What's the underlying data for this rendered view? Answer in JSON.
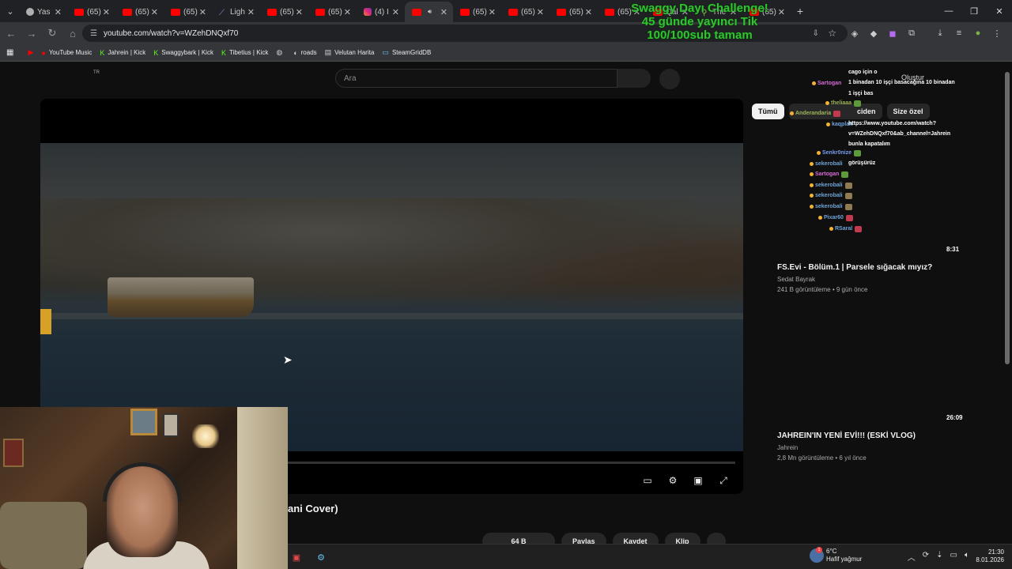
{
  "browser": {
    "tabs": [
      {
        "label": "Yas",
        "icon": "doc"
      },
      {
        "label": "(65)",
        "icon": "yt"
      },
      {
        "label": "(65)",
        "icon": "yt"
      },
      {
        "label": "(65)",
        "icon": "yt"
      },
      {
        "label": "Ligh",
        "icon": "feather"
      },
      {
        "label": "(65)",
        "icon": "yt"
      },
      {
        "label": "(65)",
        "icon": "yt"
      },
      {
        "label": "(4) I",
        "icon": "ig"
      },
      {
        "label": "",
        "icon": "yt",
        "active": true
      },
      {
        "label": "(65)",
        "icon": "yt"
      },
      {
        "label": "(65)",
        "icon": "yt"
      },
      {
        "label": "(65)",
        "icon": "yt"
      },
      {
        "label": "(65)",
        "icon": "yt"
      },
      {
        "label": "Qal",
        "icon": "yt"
      },
      {
        "label": "The",
        "icon": "person"
      },
      {
        "label": "(65)",
        "icon": "yt"
      }
    ],
    "url": "youtube.com/watch?v=WZehDNQxf70",
    "bookmarks": [
      {
        "label": "YouTube Music",
        "icon": "youtube-music-icon"
      },
      {
        "label": "Jahrein | Kick",
        "icon": "kick-icon"
      },
      {
        "label": "Swaggybark | Kick",
        "icon": "kick-icon"
      },
      {
        "label": "Tibetius | Kick",
        "icon": "kick-icon"
      },
      {
        "label": "",
        "icon": "globe-icon"
      },
      {
        "label": "roads",
        "icon": "roads-icon"
      },
      {
        "label": "Velutan Harita",
        "icon": "map-icon"
      },
      {
        "label": "SteamGridDB",
        "icon": "steam-icon"
      }
    ]
  },
  "overlay": {
    "line1": "Swaggy Dayı Challenge!",
    "line2": "45 günde yayıncı Tik",
    "line3": "100/100sub tamam"
  },
  "youtube": {
    "lang": "TR",
    "search_placeholder": "Ara",
    "create": "Oluştur",
    "video_title_partial": "ani Cover)",
    "actions": {
      "likes": "64 B",
      "share": "Paylaş",
      "save": "Kaydet",
      "clip": "Klip"
    },
    "chips": {
      "all": "Tümü",
      "middle": "ciden",
      "for_you": "Size özel"
    },
    "recommendations": [
      {
        "title": "FS.Evi - Bölüm.1 | Parsele sığacak mıyız?",
        "channel": "Sedat Bayrak",
        "meta": "241 B görüntüleme • 9 gün önce",
        "duration": "8:31"
      },
      {
        "title": "JAHREIN'IN YENİ EVİ!!! (ESKİ VLOG)",
        "channel": "Jahrein",
        "meta": "2,8 Mn görüntüleme • 6 yıl önce",
        "duration": "26:09"
      }
    ]
  },
  "chat": {
    "lines": [
      {
        "user": "",
        "text": "cago için o"
      },
      {
        "user": "Sartogan",
        "text": "1 binadan 10 işçi basacağına 10 binadan"
      },
      {
        "user": "",
        "text": "1 işçi bas"
      },
      {
        "user": "theliaaa",
        "text": ""
      },
      {
        "user": "Anderandaria",
        "text": ""
      },
      {
        "user": "kaqplan",
        "text": "https://www.youtube.com/watch?"
      },
      {
        "user": "",
        "text": "v=WZehDNQxf70&ab_channel=Jahrein"
      },
      {
        "user": "",
        "text": "bunla kapatalım"
      },
      {
        "user": "Senkr0nize",
        "text": ""
      },
      {
        "user": "sekerobali",
        "text": "görüşürüz"
      },
      {
        "user": "Sartogan",
        "text": ""
      },
      {
        "user": "sekerobali",
        "text": ""
      },
      {
        "user": "sekerobali",
        "text": ""
      },
      {
        "user": "sekerobali",
        "text": ""
      },
      {
        "user": "Pixar60",
        "text": ""
      },
      {
        "user": "RSaral",
        "text": ""
      }
    ]
  },
  "taskbar": {
    "weather_temp": "6°C",
    "weather_desc": "Hafif yağmur",
    "weather_badge": "1",
    "time": "21:30",
    "date": "8.01.2026"
  }
}
